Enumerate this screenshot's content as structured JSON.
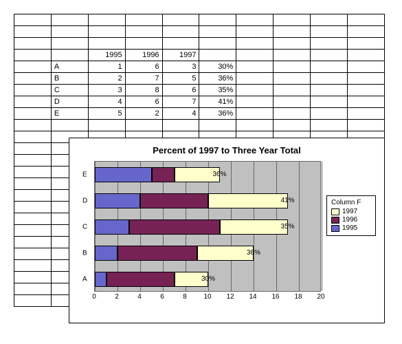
{
  "table": {
    "headers": [
      "",
      "1995",
      "1996",
      "1997",
      ""
    ],
    "rows": [
      {
        "label": "A",
        "v1995": 1,
        "v1996": 6,
        "v1997": 3,
        "pct": "30%"
      },
      {
        "label": "B",
        "v1995": 2,
        "v1996": 7,
        "v1997": 5,
        "pct": "36%"
      },
      {
        "label": "C",
        "v1995": 3,
        "v1996": 8,
        "v1997": 6,
        "pct": "35%"
      },
      {
        "label": "D",
        "v1995": 4,
        "v1996": 6,
        "v1997": 7,
        "pct": "41%"
      },
      {
        "label": "E",
        "v1995": 5,
        "v1996": 2,
        "v1997": 4,
        "pct": "36%"
      }
    ]
  },
  "chart_data": {
    "type": "bar",
    "orientation": "horizontal",
    "stacked": true,
    "title": "Percent of 1997 to Three Year Total",
    "categories": [
      "A",
      "B",
      "C",
      "D",
      "E"
    ],
    "series": [
      {
        "name": "1995",
        "values": [
          1,
          2,
          3,
          4,
          5
        ],
        "color": "#6666cc"
      },
      {
        "name": "1996",
        "values": [
          6,
          7,
          8,
          6,
          2
        ],
        "color": "#772255"
      },
      {
        "name": "1997",
        "values": [
          3,
          5,
          6,
          7,
          4
        ],
        "color": "#ffffcc"
      }
    ],
    "data_labels": [
      "30%",
      "36%",
      "35%",
      "41%",
      "36%"
    ],
    "xlim": [
      0,
      20
    ],
    "x_ticks": [
      0,
      2,
      4,
      6,
      8,
      10,
      12,
      14,
      16,
      18,
      20
    ],
    "legend_title": "Column F",
    "legend_entries": [
      "1997",
      "1996",
      "1995"
    ]
  },
  "colors": {
    "c1995": "#6666cc",
    "c1996": "#772255",
    "c1997": "#ffffcc"
  }
}
